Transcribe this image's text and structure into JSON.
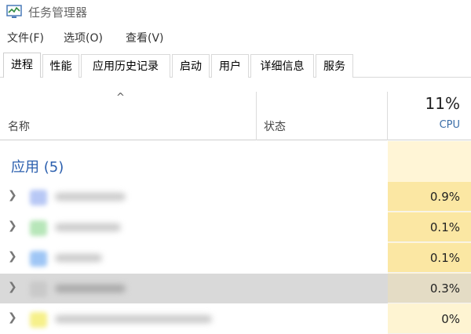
{
  "window": {
    "title": "任务管理器"
  },
  "menu": {
    "items": [
      {
        "label": "文件(F)"
      },
      {
        "label": "选项(O)"
      },
      {
        "label": "查看(V)"
      }
    ]
  },
  "tabs": [
    {
      "label": "进程",
      "active": true
    },
    {
      "label": "性能"
    },
    {
      "label": "应用历史记录"
    },
    {
      "label": "启动"
    },
    {
      "label": "用户"
    },
    {
      "label": "详细信息"
    },
    {
      "label": "服务"
    }
  ],
  "columns": {
    "name": "名称",
    "status": "状态",
    "cpu_total": "11%",
    "cpu_label": "CPU",
    "sort_indicator": "^"
  },
  "group": {
    "label": "应用 (5)"
  },
  "processes": [
    {
      "cpu": "0.9%",
      "icon_color": "#b8c8f5",
      "selected": false
    },
    {
      "cpu": "0.1%",
      "icon_color": "#b7e6b9",
      "selected": false
    },
    {
      "cpu": "0.1%",
      "icon_color": "#9fc6f5",
      "selected": false
    },
    {
      "cpu": "0.3%",
      "icon_color": "#c9c9c9",
      "selected": true
    },
    {
      "cpu": "0%",
      "icon_color": "#f6f08a",
      "selected": false
    }
  ],
  "icons": {
    "expand": "chevron-right-icon",
    "app": "task-manager-icon"
  }
}
